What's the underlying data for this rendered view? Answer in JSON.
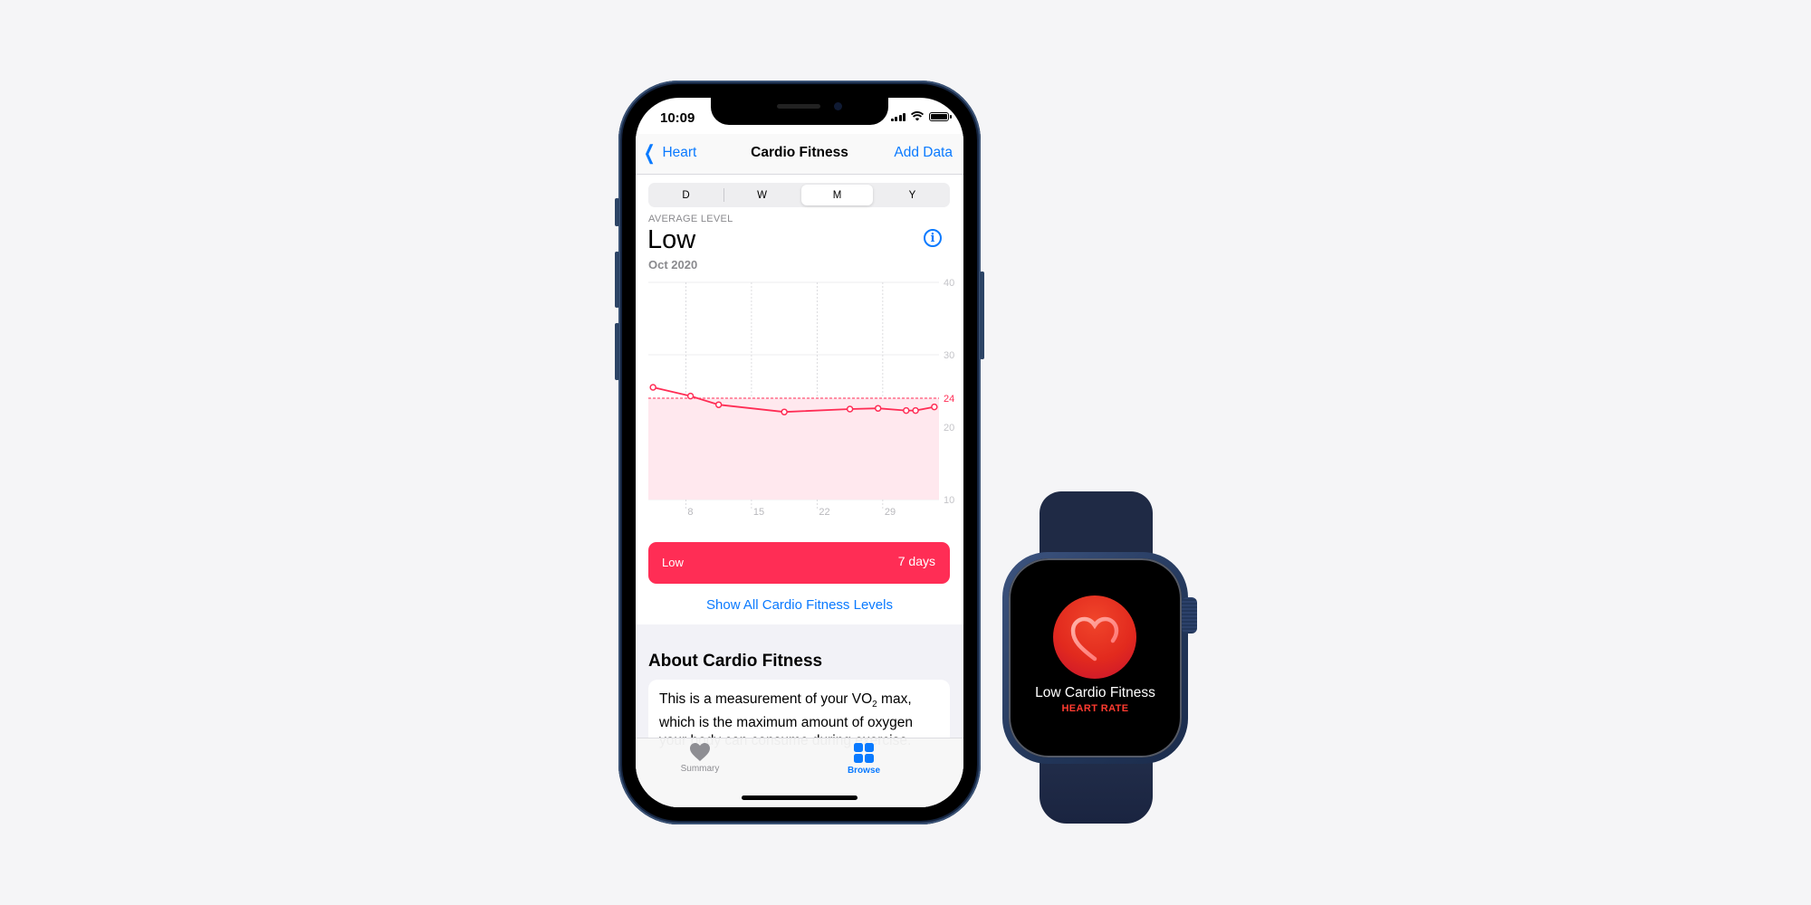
{
  "phone": {
    "status_bar": {
      "time": "10:09",
      "icons": [
        "cellular-signal-icon",
        "wifi-icon",
        "battery-icon"
      ]
    },
    "nav": {
      "back_label": "Heart",
      "title": "Cardio Fitness",
      "action_label": "Add Data"
    },
    "segments": {
      "items": [
        "D",
        "W",
        "M",
        "Y"
      ],
      "selected": "M"
    },
    "summary": {
      "label": "AVERAGE LEVEL",
      "value": "Low",
      "date": "Oct 2020",
      "info_icon": "i"
    },
    "level_bar": {
      "name": "Low",
      "duration": "7 days",
      "color": "#ff2d55"
    },
    "show_all_link": "Show All Cardio Fitness Levels",
    "about": {
      "title": "About Cardio Fitness",
      "text_before": "This is a measurement of your VO",
      "subscript": "2",
      "text_after": " max, which is the maximum amount of oxygen your body can consume during exercise."
    },
    "tabbar": {
      "items": [
        {
          "label": "Summary",
          "icon": "heart-icon",
          "active": false
        },
        {
          "label": "Browse",
          "icon": "grid-icon",
          "active": true
        }
      ],
      "active_color": "#0a7aff",
      "inactive_color": "#8e8e93"
    }
  },
  "watch": {
    "title": "Low Cardio Fitness",
    "subtitle": "HEART RATE",
    "icon": "heart-ring-icon"
  },
  "chart_data": {
    "type": "line",
    "title": "",
    "xlabel": "",
    "ylabel": "",
    "x_unit": "day of Oct 2020",
    "xlim": [
      4,
      35
    ],
    "ylim": [
      10,
      40
    ],
    "x_ticks": [
      8,
      15,
      22,
      29
    ],
    "x_tick_labels": [
      "8",
      "15",
      "22",
      "29"
    ],
    "y_ticks": [
      10,
      20,
      30,
      40
    ],
    "y_tick_labels": [
      "10",
      "20",
      "30",
      "40"
    ],
    "threshold": {
      "value": 24,
      "label": "24",
      "color": "#ff2d55",
      "shaded_below": true
    },
    "grid": true,
    "series": [
      {
        "name": "VO2 max",
        "color": "#ff2d55",
        "x": [
          4.5,
          8.5,
          11.5,
          18.5,
          25.5,
          28.5,
          31.5,
          32.5,
          34.5
        ],
        "values": [
          25.5,
          24.3,
          23.1,
          22.1,
          22.5,
          22.6,
          22.3,
          22.3,
          22.8
        ]
      }
    ]
  }
}
